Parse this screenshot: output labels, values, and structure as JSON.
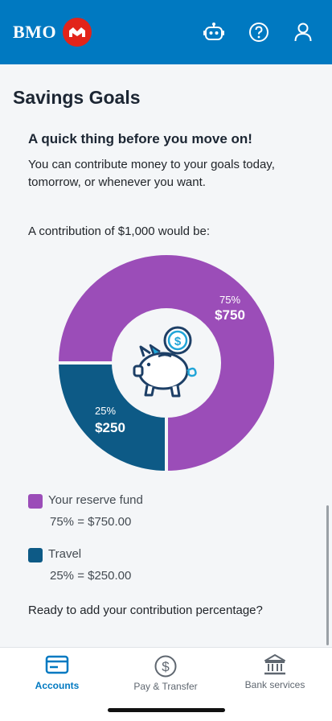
{
  "header": {
    "brand": "BMO",
    "icons": [
      "bot-icon",
      "help-icon",
      "profile-icon"
    ]
  },
  "page": {
    "title": "Savings Goals",
    "card_title": "A quick thing before you move on!",
    "body": "You can contribute money to your goals today, tomorrow, or whenever you want.",
    "contribution_text": "A contribution of $1,000 would be:",
    "ready_text": "Ready to add your contribution percentage?"
  },
  "chart_data": {
    "type": "pie",
    "total": 1000,
    "slices": [
      {
        "name": "Your reserve fund",
        "percent": 75,
        "amount": 750,
        "percent_label": "75%",
        "amount_label": "$750",
        "color": "#9b4db8"
      },
      {
        "name": "Travel",
        "percent": 25,
        "amount": 250,
        "percent_label": "25%",
        "amount_label": "$250",
        "color": "#0d5a86"
      }
    ]
  },
  "legend": [
    {
      "name": "Your reserve fund",
      "value": "75% = $750.00",
      "color": "#9b4db8"
    },
    {
      "name": "Travel",
      "value": "25% = $250.00",
      "color": "#0d5a86"
    }
  ],
  "tabs": [
    {
      "label": "Accounts",
      "icon": "card-icon",
      "active": true
    },
    {
      "label": "Pay & Transfer",
      "icon": "dollar-circle-icon",
      "active": false
    },
    {
      "label": "Bank services",
      "icon": "bank-icon",
      "active": false
    }
  ],
  "colors": {
    "brand_blue": "#0079c1",
    "brand_red": "#e2241a"
  }
}
